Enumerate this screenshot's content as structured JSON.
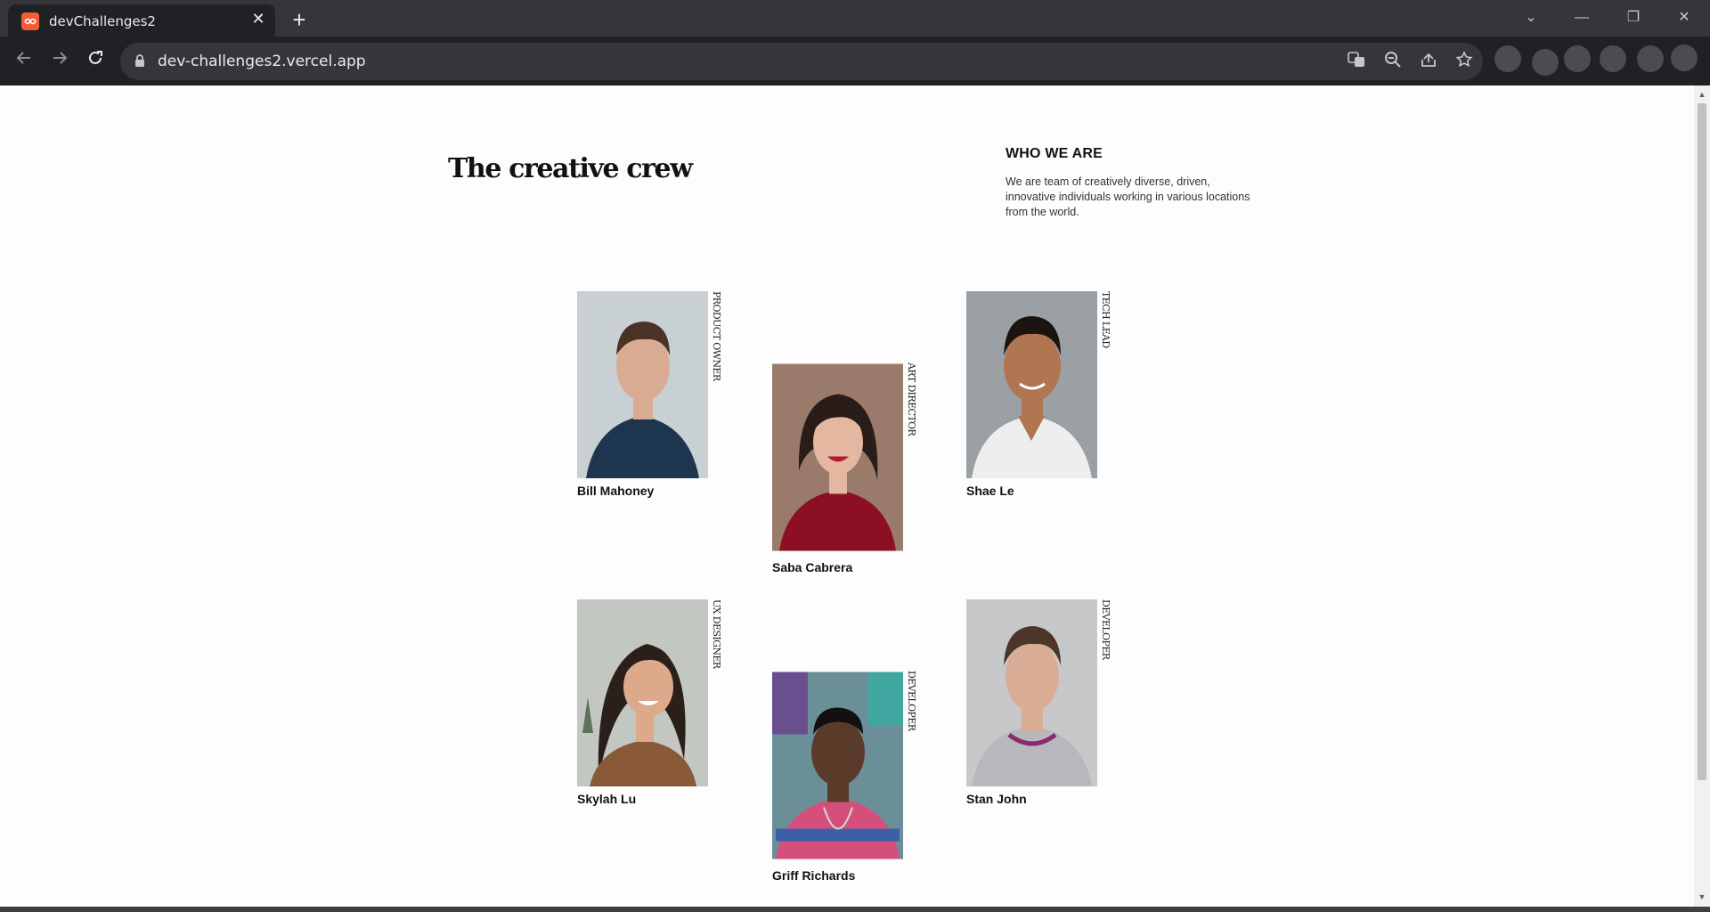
{
  "browser": {
    "tab_title": "devChallenges2",
    "url": "dev-challenges2.vercel.app",
    "window_controls": {
      "collapse": "⌄",
      "minimize": "—",
      "restore": "❐",
      "close": "✕"
    },
    "icons": [
      "back-arrow-icon",
      "forward-arrow-icon",
      "reload-icon",
      "lock-icon",
      "translate-icon",
      "zoom-icon",
      "share-icon",
      "bookmark-star-icon"
    ]
  },
  "page": {
    "heading": "The creative crew",
    "about": {
      "title": "WHO WE ARE",
      "text": "We are team of creatively diverse, driven, innovative individuals working in various locations from the world."
    },
    "members": [
      {
        "name": "Bill Mahoney",
        "role": "PRODUCT OWNER",
        "photo_colors": {
          "background": "#c9d0d4",
          "shirt": "#1e3550",
          "skin": "#d8ab92",
          "hair": "#4a3325"
        }
      },
      {
        "name": "Saba Cabrera",
        "role": "ART DIRECTOR",
        "photo_colors": {
          "background": "#9a7a6a",
          "shirt": "#8c0f24",
          "skin": "#e3b7a0",
          "hair": "#2a1c18"
        }
      },
      {
        "name": "Shae Le",
        "role": "TECH LEAD",
        "photo_colors": {
          "background": "#9aa0a4",
          "shirt": "#eeeeee",
          "skin": "#b07652",
          "hair": "#1c1410"
        }
      },
      {
        "name": "Skylah Lu",
        "role": "UX DESIGNER",
        "photo_colors": {
          "background": "#c3c7c2",
          "shirt": "#8a5a38",
          "skin": "#dca98a",
          "hair": "#2b1f1a"
        }
      },
      {
        "name": "Griff Richards",
        "role": "DEVELOPER",
        "photo_colors": {
          "background": "#6b8f99",
          "shirt": "#d4507a",
          "skin": "#5a3a28",
          "hair": "#121010"
        }
      },
      {
        "name": "Stan John",
        "role": "DEVELOPER",
        "photo_colors": {
          "background": "#c6c8ca",
          "shirt": "#b8b8bc",
          "skin": "#d9ad95",
          "hair": "#4b3628"
        }
      }
    ]
  }
}
